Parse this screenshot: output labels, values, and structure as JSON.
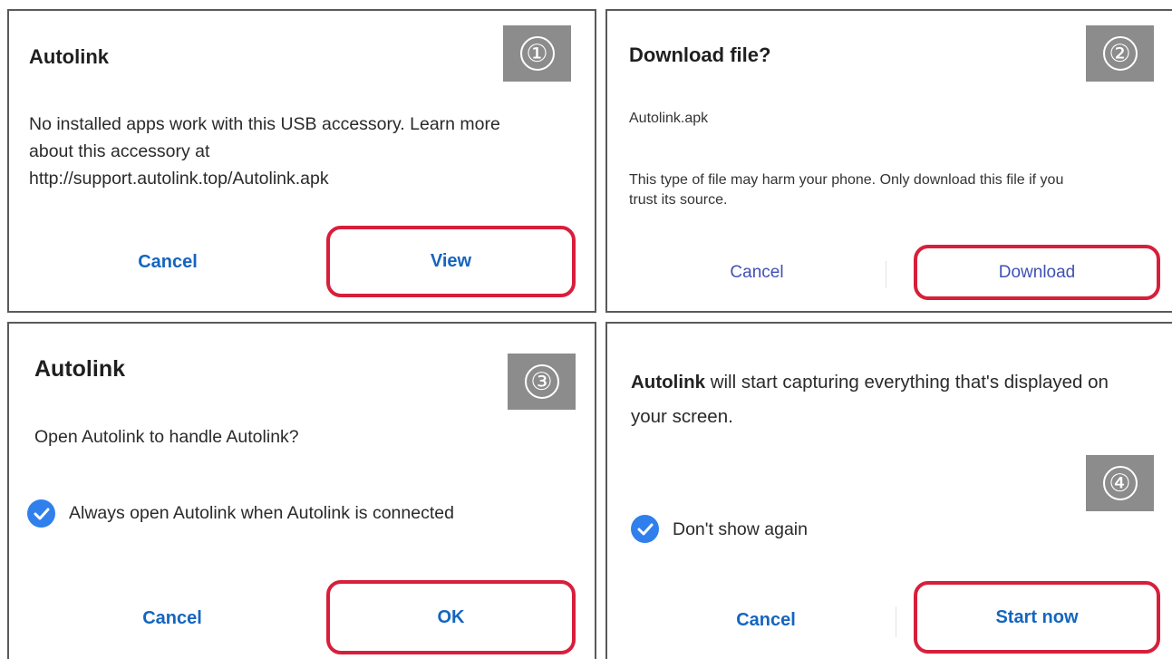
{
  "colors": {
    "highlight": "#d71f3b",
    "badge": "#8c8c8c",
    "button_blue": "#1565c0",
    "button_indigo": "#3f51b5",
    "check_blue": "#2f80ed"
  },
  "step1": {
    "badge": "①",
    "title": "Autolink",
    "line1": "No installed apps work with this USB accessory. Learn more",
    "line2": "about this accessory at",
    "line3": "http://support.autolink.top/Autolink.apk",
    "cancel": "Cancel",
    "view": "View"
  },
  "step2": {
    "badge": "②",
    "title": "Download file?",
    "filename": "Autolink.apk",
    "warning_line1": "This type of file may harm your phone. Only download this file if you",
    "warning_line2": "trust its source.",
    "cancel": "Cancel",
    "download": "Download"
  },
  "step3": {
    "badge": "③",
    "title": "Autolink",
    "question": "Open Autolink to handle Autolink?",
    "checkbox_label": "Always open Autolink when Autolink is connected",
    "cancel": "Cancel",
    "ok": "OK"
  },
  "step4": {
    "badge": "④",
    "message_app": "Autolink",
    "message_line1_rest": " will start capturing everything that's displayed on",
    "message_line2": "your screen.",
    "checkbox_label": "Don't show again",
    "cancel": "Cancel",
    "start": "Start now"
  }
}
